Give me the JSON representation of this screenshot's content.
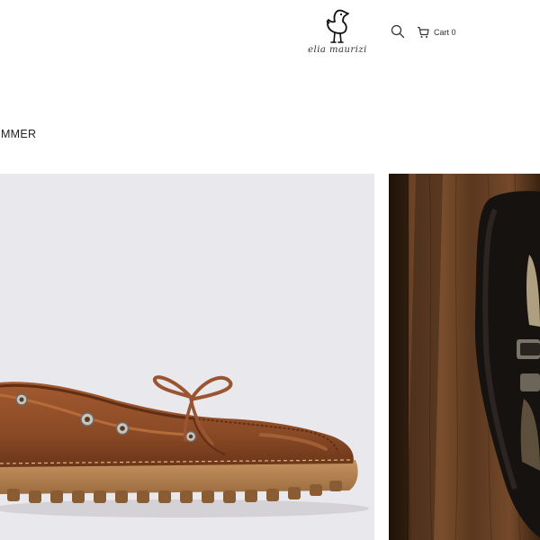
{
  "header": {
    "logo_text": "elia maurizi",
    "cart_label": "Cart 0"
  },
  "collection": {
    "title": "SUMMER"
  },
  "products": [
    {
      "image": "brown-leather-boat-shoe"
    },
    {
      "image": "dark-wooden-background-shoe"
    }
  ],
  "colors": {
    "tile_background": "#e9e8ec",
    "leather": "#8a4a26",
    "sole": "#b07d4e",
    "wood": "#5b3a23"
  }
}
